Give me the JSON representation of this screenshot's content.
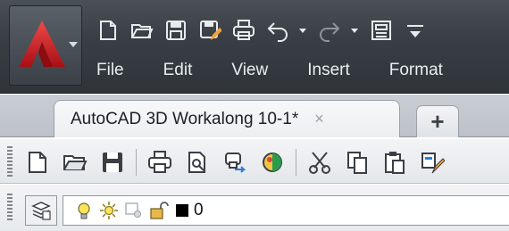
{
  "app": {
    "logo_icon": "autocad-logo-icon",
    "brand_color": "#d8232a"
  },
  "quick_access": {
    "icons": [
      "new-icon",
      "open-icon",
      "save-icon",
      "save-as-icon",
      "print-icon",
      "undo-icon",
      "redo-icon",
      "workspace-icon",
      "customize-icon"
    ]
  },
  "menu": {
    "items": [
      "File",
      "Edit",
      "View",
      "Insert",
      "Format"
    ]
  },
  "tabs": {
    "active_label": "AutoCAD 3D Workalong 10-1*",
    "close_glyph": "×",
    "new_tab_glyph": "+"
  },
  "toolbar": {
    "icons": [
      "new-icon",
      "open-icon",
      "save-icon",
      "plot-icon",
      "plot-preview-icon",
      "publish-icon",
      "render-icon",
      "cut-icon",
      "copy-icon",
      "paste-icon",
      "match-properties-icon"
    ]
  },
  "layer": {
    "current_layer": "0",
    "color": "#000000"
  }
}
